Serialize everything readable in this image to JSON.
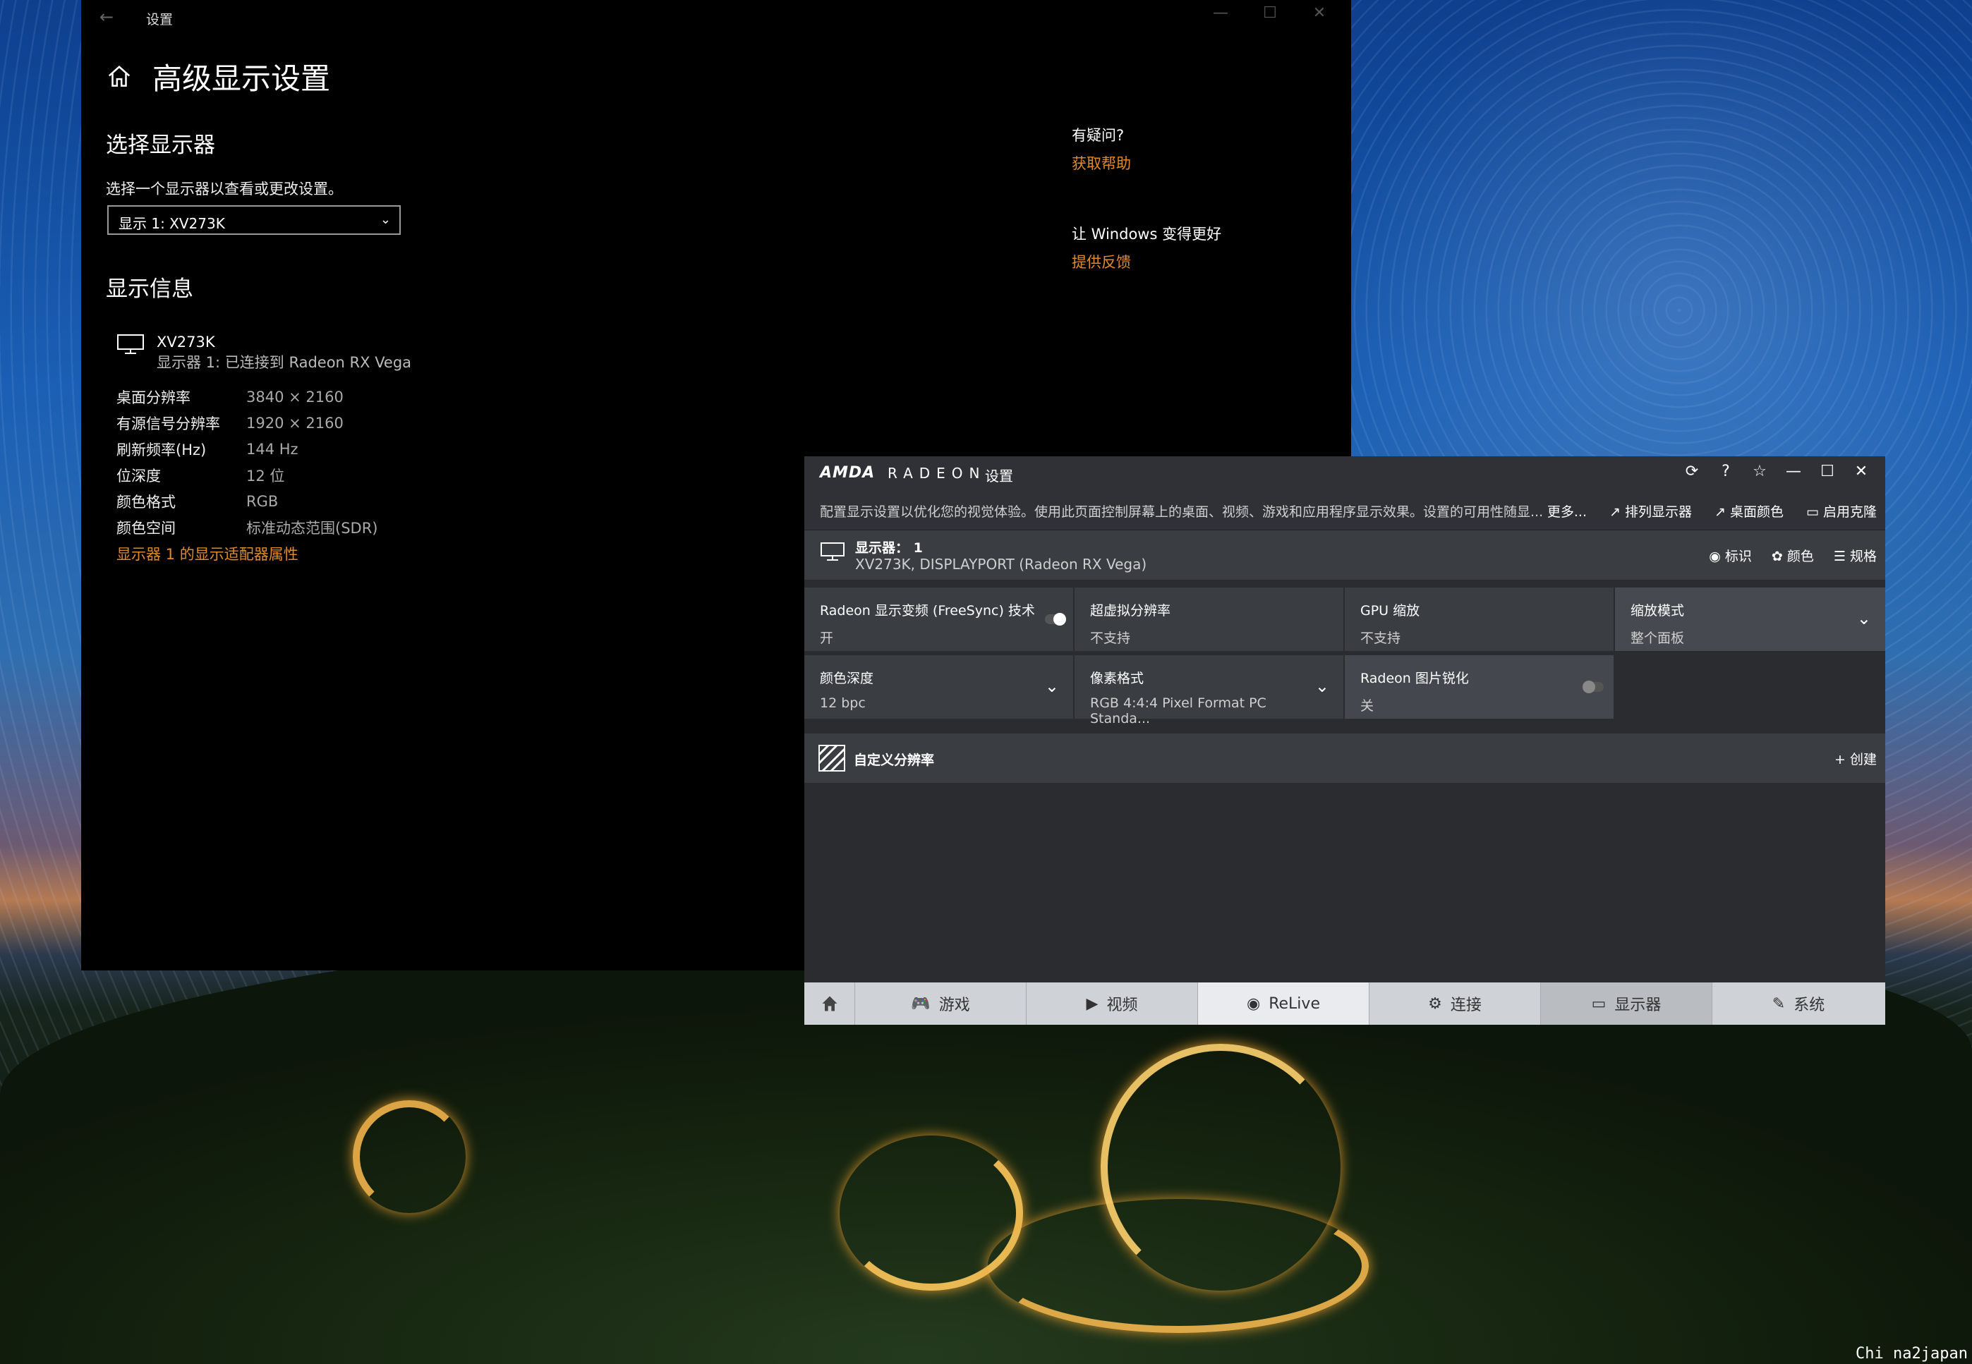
{
  "windows_settings": {
    "titlebar": {
      "back": "←",
      "title": "设置",
      "min": "—",
      "max": "☐",
      "close": "✕"
    },
    "page_title": "高级显示设置",
    "select_display": {
      "heading": "选择显示器",
      "instruction": "选择一个显示器以查看或更改设置。",
      "dropdown_value": "显示 1: XV273K"
    },
    "display_info": {
      "heading": "显示信息",
      "monitor_name": "XV273K",
      "monitor_sub": "显示器 1: 已连接到 Radeon RX Vega",
      "rows": [
        {
          "k": "桌面分辨率",
          "v": "3840 × 2160"
        },
        {
          "k": "有源信号分辨率",
          "v": "1920 × 2160"
        },
        {
          "k": "刷新频率(Hz)",
          "v": "144 Hz"
        },
        {
          "k": "位深度",
          "v": "12 位"
        },
        {
          "k": "颜色格式",
          "v": "RGB"
        },
        {
          "k": "颜色空间",
          "v": "标准动态范围(SDR)"
        }
      ],
      "adapter_link": "显示器 1 的显示适配器属性"
    },
    "side": {
      "question": "有疑问?",
      "help_link": "获取帮助",
      "improve": "让 Windows 变得更好",
      "feedback_link": "提供反馈"
    }
  },
  "amd": {
    "logo": "AMDA",
    "brand": "RADEON",
    "title": "设置",
    "description": "配置显示设置以优化您的视觉体验。使用此页面控制屏幕上的桌面、视频、游戏和应用程序显示效果。设置的可用性随显...",
    "more": "更多...",
    "links": [
      "排列显示器",
      "桌面颜色",
      "启用克隆"
    ],
    "display": {
      "name": "显示器：  1",
      "sub": "XV273K, DISPLAYPORT (Radeon RX Vega)",
      "actions": [
        "标识",
        "颜色",
        "规格"
      ]
    },
    "tiles": [
      {
        "label": "Radeon 显示变频 (FreeSync) 技术",
        "value": "开"
      },
      {
        "label": "超虚拟分辨率",
        "value": "不支持"
      },
      {
        "label": "GPU 缩放",
        "value": "不支持"
      },
      {
        "label": "缩放模式",
        "value": "整个面板"
      },
      {
        "label": "颜色深度",
        "value": "12 bpc"
      },
      {
        "label": "像素格式",
        "value": "RGB 4:4:4 Pixel Format PC Standa..."
      },
      {
        "label": "Radeon 图片锐化",
        "value": "关"
      }
    ],
    "custom_res": {
      "label": "自定义分辨率",
      "create": "+ 创建"
    },
    "tabs": [
      "游戏",
      "视频",
      "ReLive",
      "连接",
      "显示器",
      "系统"
    ],
    "active_tab": "显示器",
    "accent": "#e08a2a"
  },
  "watermark": "Chi na2japan"
}
